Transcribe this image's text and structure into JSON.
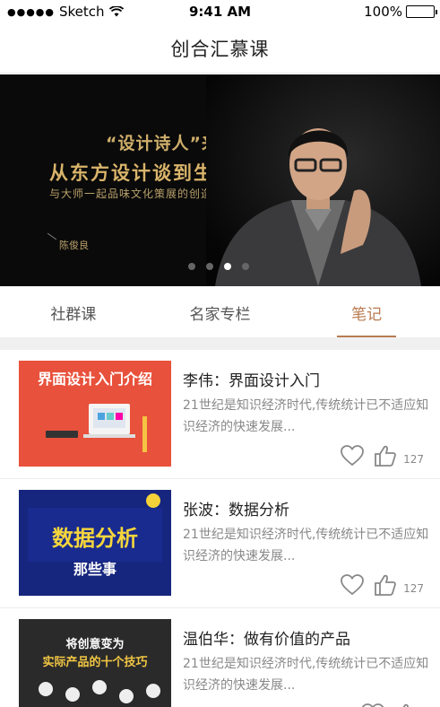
{
  "status": {
    "carrier": "Sketch",
    "time": "9:41 AM",
    "battery": "100%"
  },
  "nav": {
    "title": "创合汇慕课"
  },
  "banner": {
    "quote": "“设计诗人”来了",
    "headline": "从东方设计谈到生活美学",
    "subline": "与大师一起品味文化策展的创造魅力",
    "author": "陈俊良",
    "slide_count": 4,
    "active_slide": 3
  },
  "tabs": [
    {
      "label": "社群课",
      "active": false
    },
    {
      "label": "名家专栏",
      "active": false
    },
    {
      "label": "笔记",
      "active": true
    }
  ],
  "articles": [
    {
      "title": "李伟：界面设计入门",
      "desc": "21世纪是知识经济时代,传统统计已不适应知识经济的快速发展...",
      "likes": "127",
      "thumb_text": "界面设计入门介绍",
      "thumb_color": "#e8513b"
    },
    {
      "title": "张波：数据分析",
      "desc": "21世纪是知识经济时代,传统统计已不适应知识经济的快速发展...",
      "likes": "127",
      "thumb_text": "数据分析",
      "thumb_text2": "那些事",
      "thumb_color": "#16257e"
    },
    {
      "title": "温伯华：做有价值的产品",
      "desc": "21世纪是知识经济时代,传统统计已不适应知识经济的快速发展...",
      "likes": "",
      "thumb_text": "将创意变为",
      "thumb_text2": "实际产品的十个技巧",
      "thumb_color": "#2a2a2a"
    }
  ],
  "colors": {
    "accent": "#b97b50",
    "gold": "#d9b46a"
  }
}
